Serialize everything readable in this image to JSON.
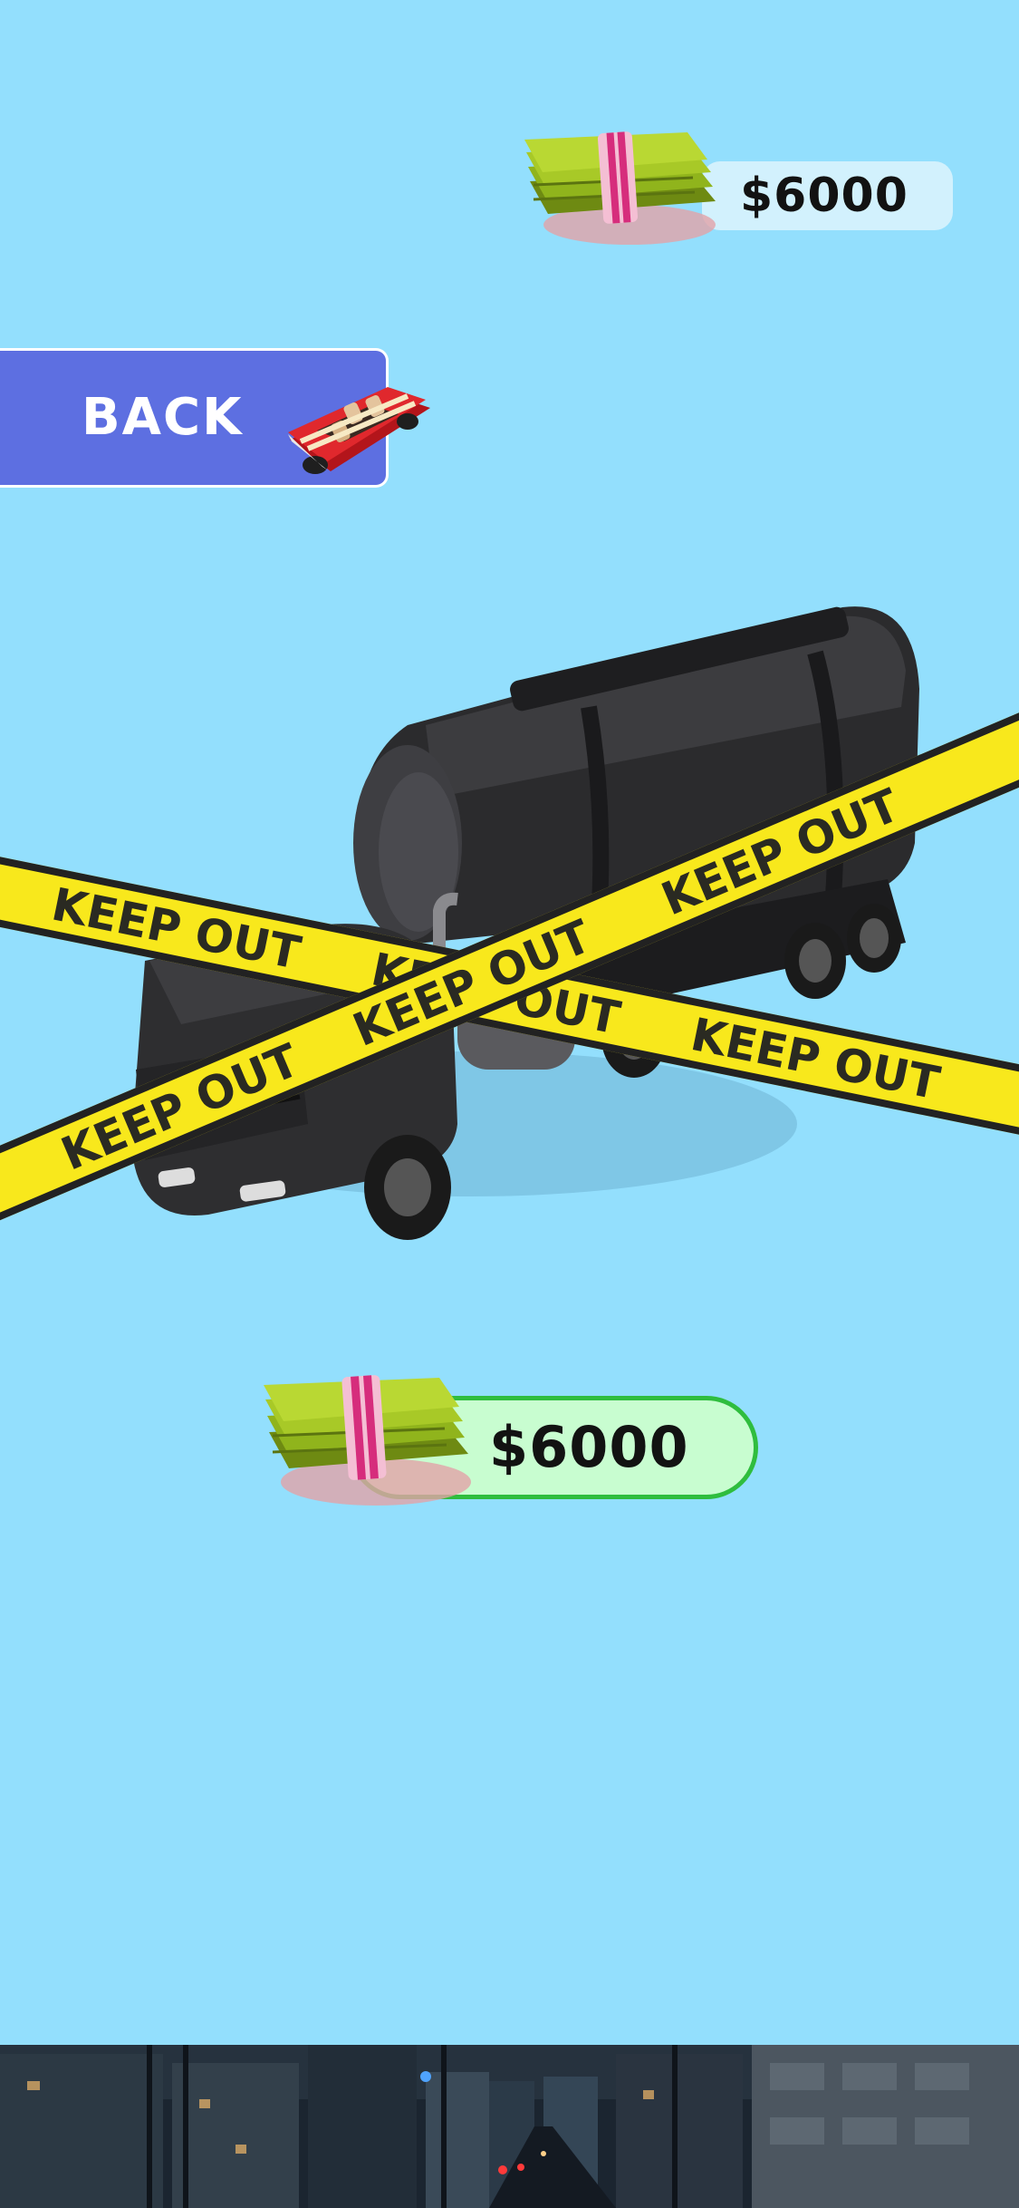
{
  "header": {
    "balance_text": "$6000",
    "balance_icon": "cash-stack-icon"
  },
  "back_button": {
    "label": "BACK",
    "icon": "convertible-car-icon"
  },
  "vehicle": {
    "name_icon": "tanker-truck-icon",
    "locked": true,
    "tape_text": "KEEP OUT"
  },
  "purchase": {
    "price_text": "$6000",
    "price_icon": "cash-stack-icon"
  },
  "colors": {
    "background": "#93dffd",
    "back_button": "#5d6fe1",
    "price_fill": "#c8fdd0",
    "price_border": "#2fbd3e",
    "balance_fill": "#d2f1fd",
    "tape_yellow": "#f8e81c"
  }
}
